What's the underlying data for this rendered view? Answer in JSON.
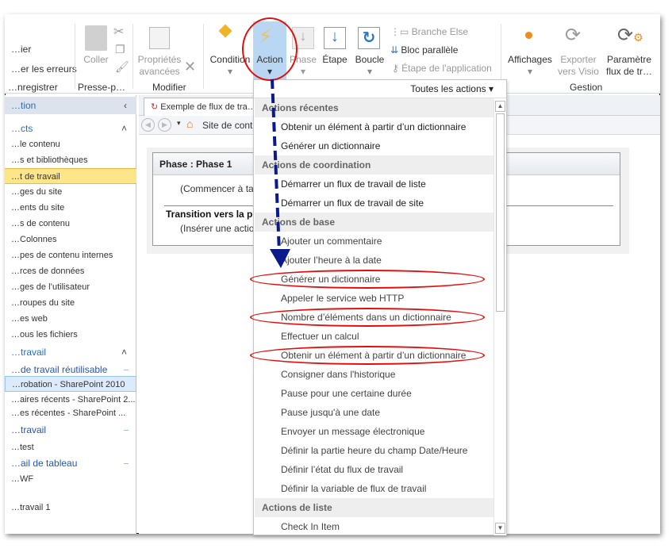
{
  "ribbon": {
    "left_partial": [
      "…ier",
      "…er les erreurs",
      "…nregistrer"
    ],
    "coller": "Coller",
    "presse_group": "Presse-p…",
    "proprietes": [
      "Propriétés",
      "avancées"
    ],
    "modifier_group": "Modifier",
    "condition": "Condition",
    "action": "Action",
    "phase": "Phase",
    "etape": "Étape",
    "boucle": "Boucle",
    "branche_else": "Branche Else",
    "bloc_parallele": "Bloc parallèle",
    "etape_application": "Étape de l'application",
    "affichages": "Affichages",
    "exporter": [
      "Exporter",
      "vers Visio"
    ],
    "parametres": [
      "Paramètre",
      "flux de tr…"
    ],
    "gestion_group": "Gestion"
  },
  "nav": {
    "title": "…tion",
    "sections": [
      {
        "label": "…cts",
        "type": "header"
      },
      {
        "label": "…le contenu"
      },
      {
        "label": "…s et bibliothèques"
      },
      {
        "label": "…t de travail",
        "selected": true
      },
      {
        "label": "…ges du site"
      },
      {
        "label": "…ents du site"
      },
      {
        "label": "…s de contenu"
      },
      {
        "label": "…Colonnes"
      },
      {
        "label": "…pes de contenu internes"
      },
      {
        "label": "…rces de données"
      },
      {
        "label": "…ges de l’utilisateur"
      },
      {
        "label": "…roupes du site"
      },
      {
        "label": "…es web"
      },
      {
        "label": "…ous les fichiers"
      },
      {
        "label": "…travail",
        "type": "header"
      },
      {
        "label": "…de travail réutilisable",
        "type": "group"
      },
      {
        "label": "…robation - SharePoint 2010",
        "hover": true
      },
      {
        "label": "…aires récents - SharePoint 2..."
      },
      {
        "label": "…es récentes - SharePoint ..."
      },
      {
        "label": "…travail",
        "type": "group"
      },
      {
        "label": "…test"
      },
      {
        "label": "…ail de tableau",
        "type": "group"
      },
      {
        "label": "…WF"
      },
      {
        "label": "…travail 1"
      }
    ]
  },
  "main": {
    "tab_title": "Exemple de flux de tra…",
    "breadcrumb": "Site de cont…",
    "phase_title": "Phase : Phase 1",
    "phase_hint": "(Commencer à tap…",
    "transition_title": "Transition vers la ph…",
    "transition_hint": "(Insérer une action…"
  },
  "menu": {
    "header": "Toutes les actions",
    "rows": [
      {
        "type": "section",
        "label": "Actions récentes"
      },
      {
        "label": "Obtenir un élément à partir d’un dictionnaire",
        "dark": true
      },
      {
        "label": "Générer un dictionnaire",
        "dark": true
      },
      {
        "type": "section",
        "label": "Actions de coordination"
      },
      {
        "label": "Démarrer un flux de travail de liste",
        "dark": true
      },
      {
        "label": "Démarrer un flux de travail de site",
        "dark": true
      },
      {
        "type": "section",
        "label": "Actions de base"
      },
      {
        "label": "Ajouter un commentaire"
      },
      {
        "label": "Ajouter l’heure à la date"
      },
      {
        "label": "Générer un dictionnaire",
        "highlighted": true
      },
      {
        "label": "Appeler le service web HTTP"
      },
      {
        "label": "Nombre d’éléments dans un dictionnaire",
        "highlighted": true
      },
      {
        "label": "Effectuer un calcul"
      },
      {
        "label": "Obtenir un élément à partir d’un dictionnaire",
        "highlighted": true
      },
      {
        "label": "Consigner dans l'historique"
      },
      {
        "label": "Pause pour une certaine durée"
      },
      {
        "label": "Pause jusqu'à une date"
      },
      {
        "label": "Envoyer un message électronique"
      },
      {
        "label": "Définir la partie heure du champ Date/Heure"
      },
      {
        "label": "Définir l’état du flux de travail"
      },
      {
        "label": "Définir la variable de flux de travail"
      },
      {
        "type": "section",
        "label": "Actions de liste"
      },
      {
        "label": "Check In Item"
      }
    ]
  },
  "colors": {
    "annotation_red": "#e01010",
    "arrow_blue": "#0a1a8a",
    "selected_nav": "#fde58a",
    "action_pressed": "#b9d7f3"
  }
}
